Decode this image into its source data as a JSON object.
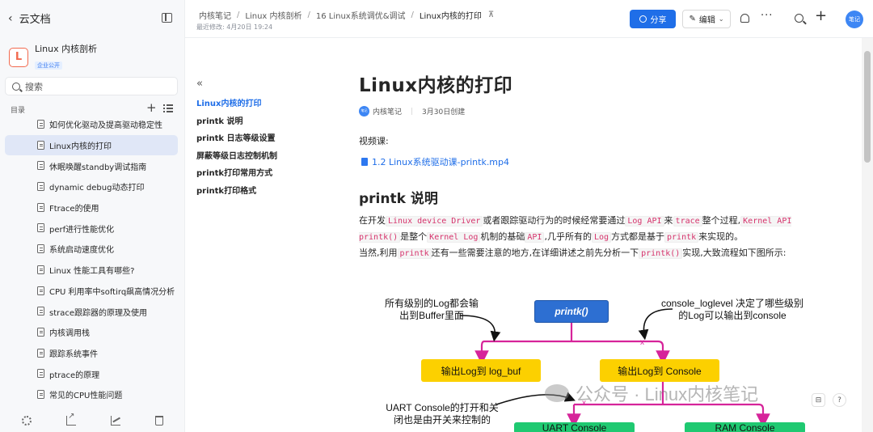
{
  "sidebar": {
    "back_label": "云文档",
    "kb_logo": "L",
    "kb_name": "Linux 内核剖析",
    "kb_badge": "企业公开",
    "search_placeholder": "搜索",
    "toc_label": "目录",
    "items": [
      {
        "label": "如何优化驱动及提高驱动稳定性"
      },
      {
        "label": "Linux内核的打印"
      },
      {
        "label": "休眠唤醒standby调试指南"
      },
      {
        "label": "dynamic debug动态打印"
      },
      {
        "label": "Ftrace的使用"
      },
      {
        "label": "perf进行性能优化"
      },
      {
        "label": "系统启动速度优化"
      },
      {
        "label": "Linux 性能工具有哪些?"
      },
      {
        "label": "CPU 利用率中softirq飙高情况分析"
      },
      {
        "label": "strace跟踪器的原理及使用"
      },
      {
        "label": "内核调用栈"
      },
      {
        "label": "跟踪系统事件"
      },
      {
        "label": "ptrace的原理"
      },
      {
        "label": "常见的CPU性能问题"
      }
    ]
  },
  "header": {
    "breadcrumbs": [
      "内核笔记",
      "Linux 内核剖析",
      "16 Linux系统调优&调试",
      "Linux内核的打印"
    ],
    "modified": "最近修改: 4月20日 19:24",
    "share_label": "分享",
    "edit_label": "编辑",
    "more_label": "···",
    "avatar_text": "笔记"
  },
  "outline": {
    "items": [
      "Linux内核的打印",
      "printk 说明",
      "printk 日志等级设置",
      "屏蔽等级日志控制机制",
      "printk打印常用方式",
      "printk打印格式"
    ]
  },
  "article": {
    "title": "Linux内核的打印",
    "author": "内核笔记",
    "author_avatar": "笔记",
    "created": "3月30日创建",
    "video_label": "视频课:",
    "video_link": "1.2 Linux系统驱动课-printk.mp4",
    "section_title": "printk 说明",
    "p1": {
      "t1": "在开发",
      "c1": "Linux device Driver",
      "t2": "或者跟踪驱动行为的时候经常要通过",
      "c2": "Log API",
      "t3": "来",
      "c3": "trace",
      "t4": "整个过程,",
      "c4": "Kernel API printk()",
      "t5": "是整个",
      "c5": "Kernel Log",
      "t6": "机制的基础",
      "c6": "API",
      "t7": ",几乎所有的",
      "c7": "Log",
      "t8": "方式都是基于",
      "c8": "printk",
      "t9": "来实现的。"
    },
    "p2": {
      "t1": "当然,利用",
      "c1": "printk",
      "t2": "还有一些需要注意的地方,在详细讲述之前先分析一下",
      "c2": "printk()",
      "t3": "实现,大致流程如下图所示:"
    }
  },
  "diagram": {
    "note_left": "所有级别的Log都会输出到Buffer里面",
    "note_left_l1": "所有级别的Log都会输",
    "note_left_l2": "出到Buffer里面",
    "note_right_l1": "console_loglevel 决定了哪些级别",
    "note_right_l2": "的Log可以输出到console",
    "printk": "printk()",
    "box_buf": "输出Log到 log_buf",
    "box_console": "输出Log到 Console",
    "note_uart_l1": "UART Console的打开和关",
    "note_uart_l2": "闭也是由开关来控制的",
    "box_uart": "UART Console",
    "box_ram": "RAM Console"
  },
  "watermark": "公众号 · Linux内核笔记",
  "colors": {
    "accent": "#1f6ee8",
    "printk_box": "#2d6fd2",
    "yellow_box": "#fcd000",
    "green_box": "#1fc971",
    "arrow": "#d6249a"
  }
}
